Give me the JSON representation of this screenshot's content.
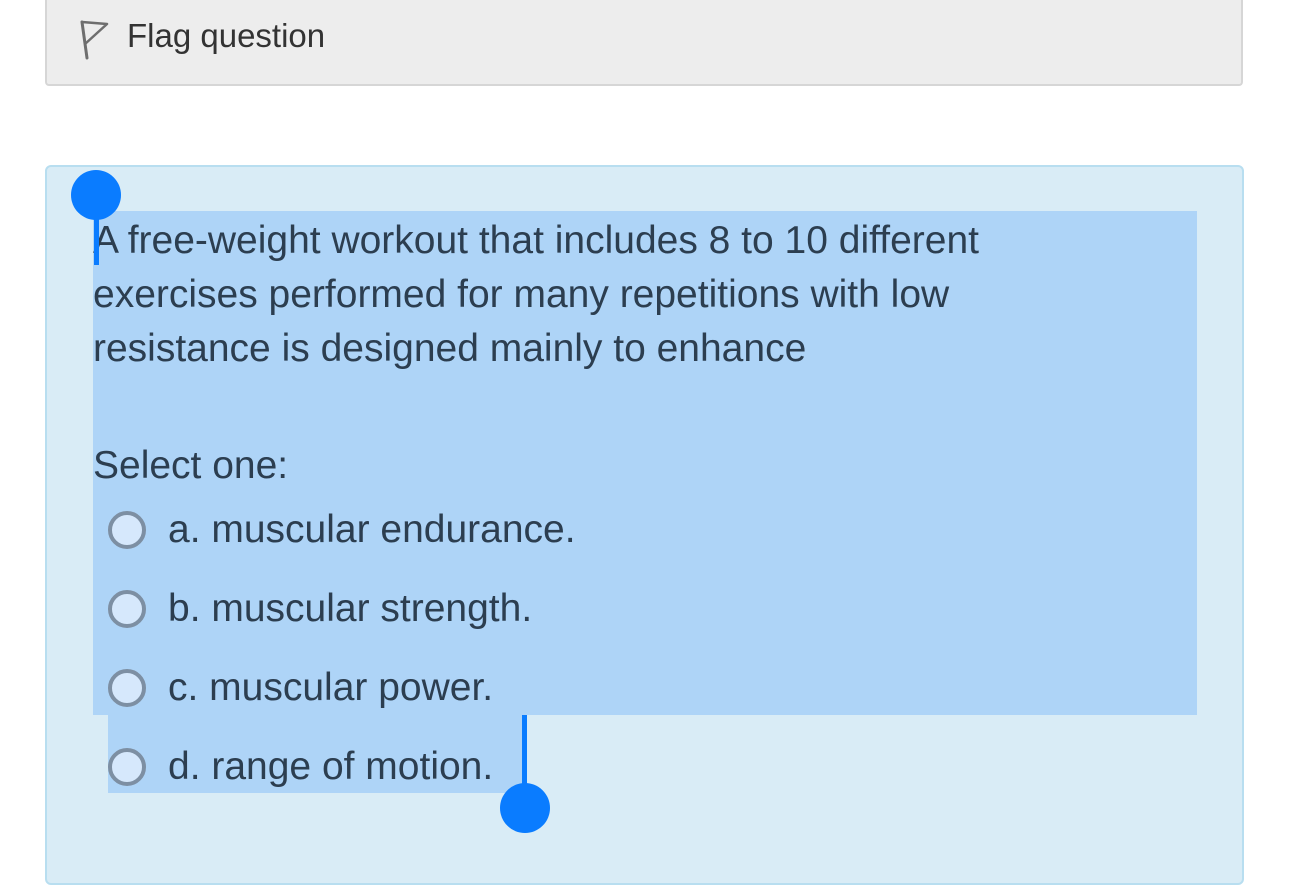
{
  "flag": {
    "label": "Flag question",
    "icon": "flag-outline-icon"
  },
  "question": {
    "text": "A free-weight workout that includes 8 to 10 different exercises performed for many repetitions with low resistance is designed mainly to enhance",
    "prompt": "Select one:",
    "options": [
      {
        "label": "a. muscular endurance.",
        "selected": false
      },
      {
        "label": "b. muscular strength.",
        "selected": false
      },
      {
        "label": "c. muscular power.",
        "selected": false
      },
      {
        "label": "d. range of motion.",
        "selected": false
      }
    ]
  },
  "selection": {
    "highlight_color": "#aed4f7",
    "handle_color": "#0a7cff"
  },
  "colors": {
    "card_background": "#d9ecf6",
    "flag_bar_background": "#ededed",
    "text": "#2c3e50"
  }
}
